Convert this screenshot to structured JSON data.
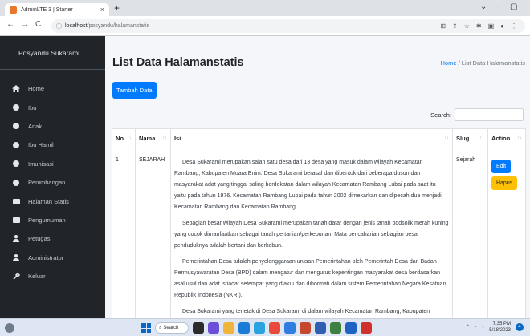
{
  "browser": {
    "tab_title": "AdminLTE 3 | Starter",
    "tab_close": "×",
    "new_tab": "+",
    "url_host": "localhost",
    "url_path": "/posyandu/halamanstatis",
    "minimize": "⌄",
    "restore": "−",
    "maximize": "▢",
    "back": "←",
    "forward": "→",
    "reload": "C"
  },
  "sidebar": {
    "brand": "Posyandu Sukarami",
    "items": [
      {
        "label": "Home",
        "icon": "home-icon"
      },
      {
        "label": "Ibu",
        "icon": "circle-icon"
      },
      {
        "label": "Anak",
        "icon": "circle-icon"
      },
      {
        "label": "Ibu Hamil",
        "icon": "circle-icon"
      },
      {
        "label": "Imunisasi",
        "icon": "circle-icon"
      },
      {
        "label": "Penimbangan",
        "icon": "circle-icon"
      },
      {
        "label": "Halaman Statis",
        "icon": "list-icon"
      },
      {
        "label": "Pengumuman",
        "icon": "list-icon"
      },
      {
        "label": "Petugas",
        "icon": "user-icon"
      },
      {
        "label": "Administrator",
        "icon": "user-icon"
      },
      {
        "label": "Keluar",
        "icon": "logout-icon"
      }
    ]
  },
  "page": {
    "title": "List Data Halamanstatis",
    "breadcrumb_home": "Home",
    "breadcrumb_sep": "/",
    "breadcrumb_current": "List Data Halamanstatis",
    "add_button": "Tambah Data",
    "search_label": "Search:"
  },
  "table": {
    "headers": [
      "No",
      "Nama",
      "Isi",
      "Slug",
      "Action"
    ],
    "rows": [
      {
        "no": "1",
        "nama": "SEJARAH",
        "isi": [
          "Desa Sukarami merupakan salah satu desa dari 13 desa yang masuk dalam wilayah Kecamatan Rambang, Kabupaten Muara Enim. Desa Sukarami berasal dan dibentuk dari beberapa dusun dan masyarakat adat yang tinggal saling berdekatan dalam wilayah Kecamatan Rambang Lubai pada saat itu yaitu pada tahun 1976. Kecamatan Rambang Lubai pada tahun 2002 dimekarkan dan dipecah dua menjadi Kecamatan Rambang dan Kecamatan Rambang .",
          "Sebagian besar wilayah Desa Sukarami merupakan tanah datar dengan jenis tanah podsolik merah kuning yang cocok dimanfaatkan sebagai tanah pertanian/perkebunan. Mata pencaharian sebagian besar penduduknya adalah bertani dan berkebun.",
          "Pemerintahan Desa adalah penyelenggaraan urusan Pemerintahan oleh Pemerintah Desa dan Badan Permusyawaratan Desa (BPD) dalam mengatur dan mengurus kepentingan masyarakat desa berdasarkan asal usul dan adat istiadat setempat yang diakui dan dihormati dalam sistem Pemerintahan Negara Kesatuan Republik Indonesia (NKRI).",
          "Desa Sukarami yang terletak di Desa Sukarami di dalam wilayah Kecamatan Rambang, Kabupaten"
        ],
        "slug": "Sejarah",
        "edit_label": "Edit",
        "delete_label": "Hapus"
      }
    ]
  },
  "taskbar": {
    "search": "Search",
    "time": "7:35 PM",
    "date": "5/18/2023",
    "notif_count": "4"
  },
  "colors": {
    "primary": "#007bff",
    "warning": "#ffc107",
    "sidebar_bg": "#212529",
    "content_bg": "#f4f6f9"
  }
}
